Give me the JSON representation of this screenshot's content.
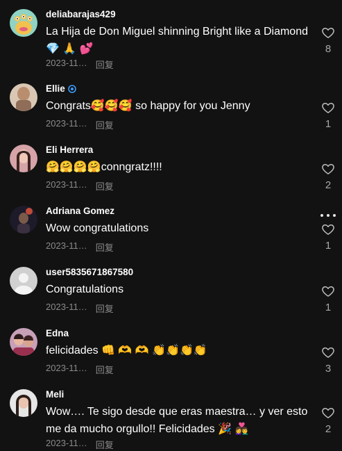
{
  "comments": [
    {
      "username": "deliabarajas429",
      "text": "La Hija de Don Miguel shinning Bright like a Diamond 💎 🙏 💕",
      "date": "2023-11…",
      "reply": "回复",
      "likes": "8",
      "avatar": "monster-avatar",
      "verified": false
    },
    {
      "username": "Ellie",
      "text": "Congrats🥰🥰🥰 so happy for you Jenny",
      "date": "2023-11…",
      "reply": "回复",
      "likes": "1",
      "avatar": "photo-avatar",
      "verified": true
    },
    {
      "username": "Eli Herrera",
      "text": "🤗🤗🤗🤗conngratz!!!!",
      "date": "2023-11…",
      "reply": "回复",
      "likes": "2",
      "avatar": "photo-avatar",
      "verified": false
    },
    {
      "username": "Adriana Gomez",
      "text": "Wow congratulations",
      "date": "2023-11…",
      "reply": "回复",
      "likes": "1",
      "avatar": "photo-avatar",
      "verified": false
    },
    {
      "username": "user5835671867580",
      "text": "Congratulations",
      "date": "2023-11…",
      "reply": "回复",
      "likes": "1",
      "avatar": "default-avatar",
      "verified": false
    },
    {
      "username": "Edna",
      "text": "felicidades 👊 🫶 🫶 👏👏👏👏",
      "date": "2023-11…",
      "reply": "回复",
      "likes": "3",
      "avatar": "photo-avatar",
      "verified": false
    },
    {
      "username": "Meli",
      "text": "Wow…. Te sigo desde que eras maestra… y ver esto me da mucho orgullo!! Felicidades 🎉 👩‍❤️‍👨",
      "date": "2023-11…",
      "reply": "回复",
      "likes": "2",
      "avatar": "photo-avatar",
      "verified": false
    }
  ],
  "colors": {
    "background": "#121212",
    "meta": "#8a8a8a",
    "verified": "#3b9cff"
  }
}
